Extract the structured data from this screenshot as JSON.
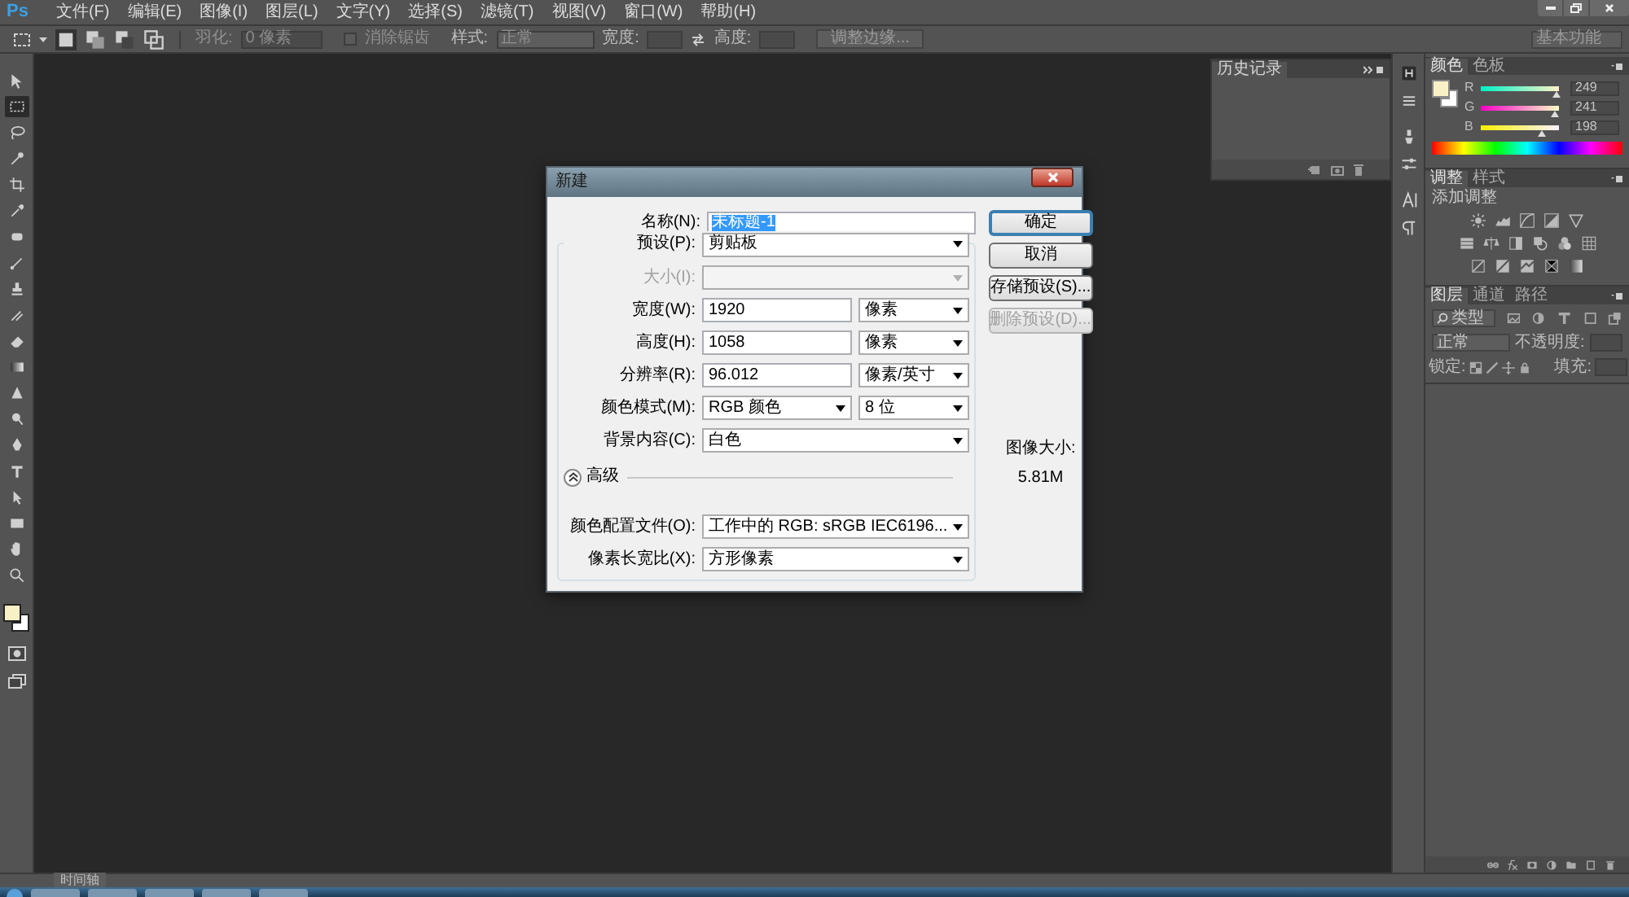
{
  "menu_bar": {
    "logo": "Ps",
    "menus": [
      "文件(F)",
      "编辑(E)",
      "图像(I)",
      "图层(L)",
      "文字(Y)",
      "选择(S)",
      "滤镜(T)",
      "视图(V)",
      "窗口(W)",
      "帮助(H)"
    ]
  },
  "options_bar": {
    "feather_label": "羽化:",
    "feather_value": "0 像素",
    "antialias": {
      "label": "消除锯齿",
      "checked": false,
      "disabled": true
    },
    "style_label": "样式:",
    "style_value": "正常",
    "width_label": "宽度:",
    "height_label": "高度:",
    "refine_button": "调整边缘...",
    "workspace": "基本功能"
  },
  "tools": [
    {
      "selected": false
    },
    {
      "selected": true
    },
    {
      "selected": false
    },
    {
      "selected": false
    },
    {
      "selected": false
    },
    {
      "selected": false
    },
    {
      "selected": false
    },
    {
      "selected": false
    },
    {
      "selected": false
    },
    {
      "selected": false
    },
    {
      "selected": false
    },
    {
      "selected": false
    },
    {
      "selected": false
    },
    {
      "selected": false
    },
    {
      "selected": false
    },
    {
      "selected": false
    },
    {
      "selected": false
    },
    {
      "selected": false
    },
    {
      "selected": false
    },
    {
      "selected": false
    }
  ],
  "history_panel": {
    "tab": "历史记录"
  },
  "color_panel": {
    "tabs": [
      {
        "label": "颜色",
        "selected": true
      },
      {
        "label": "色板",
        "selected": false
      }
    ],
    "foreground": {
      "color": "#f9f1c6"
    },
    "background": {
      "color": "#ffffff"
    },
    "channels": [
      {
        "name": "R",
        "value": "249",
        "level": 0.976
      },
      {
        "name": "G",
        "value": "241",
        "level": 0.945
      },
      {
        "name": "B",
        "value": "198",
        "level": 0.776
      }
    ]
  },
  "adjustments_panel": {
    "tabs": [
      {
        "label": "调整",
        "selected": true
      },
      {
        "label": "样式",
        "selected": false
      }
    ],
    "heading": "添加调整"
  },
  "layers_panel": {
    "tabs": [
      {
        "label": "图层",
        "selected": true
      },
      {
        "label": "通道",
        "selected": false
      },
      {
        "label": "路径",
        "selected": false
      }
    ],
    "filter": "类型",
    "blend_mode": "正常",
    "opacity_label": "不透明度:",
    "lock_label": "锁定:",
    "fill_label": "填充:"
  },
  "timeline": {
    "tab": "时间轴"
  },
  "dialog": {
    "title": "新建",
    "name_label": "名称(N):",
    "name_value": "未标题-1",
    "name_selected": true,
    "preset_label": "预设(P):",
    "preset_value": "剪贴板",
    "rows": [
      {
        "label": "大小(I):",
        "kind": "select",
        "disabled": true
      },
      {
        "label": "宽度(W):",
        "kind": "input",
        "value": "1920",
        "unit": "像素",
        "disabled": false
      },
      {
        "label": "高度(H):",
        "kind": "input",
        "value": "1058",
        "unit": "像素",
        "disabled": false
      },
      {
        "label": "分辨率(R):",
        "kind": "input",
        "value": "96.012",
        "unit": "像素/英寸",
        "disabled": false
      },
      {
        "label": "颜色模式(M):",
        "kind": "select",
        "value": "RGB 颜色",
        "unit": "8 位",
        "disabled": false
      },
      {
        "label": "背景内容(C):",
        "kind": "select",
        "value": "白色",
        "disabled": false
      }
    ],
    "advanced_label": "高级",
    "advanced_expanded": true,
    "advanced_rows": [
      {
        "label": "颜色配置文件(O):",
        "kind": "select",
        "value": "工作中的 RGB: sRGB IEC6196...",
        "disabled": false
      },
      {
        "label": "像素长宽比(X):",
        "kind": "select",
        "value": "方形像素",
        "disabled": false
      }
    ],
    "buttons": [
      {
        "label": "确定",
        "default": true,
        "disabled": false
      },
      {
        "label": "取消",
        "default": false,
        "disabled": false
      },
      {
        "label": "存储预设(S)...",
        "default": false,
        "disabled": false
      },
      {
        "label": "删除预设(D)...",
        "default": false,
        "disabled": true
      }
    ],
    "image_size_label": "图像大小:",
    "image_size_value": "5.81M"
  }
}
